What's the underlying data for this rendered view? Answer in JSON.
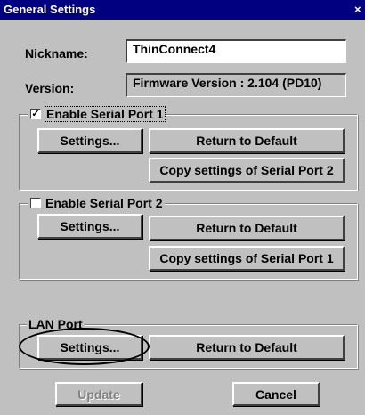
{
  "window": {
    "title": "General Settings",
    "close_glyph": "×"
  },
  "general": {
    "nickname_label": "Nickname:",
    "nickname_value": "ThinConnect4",
    "version_label": "Version:",
    "version_value": "Firmware Version : 2.104  (PD10)"
  },
  "serial1": {
    "enable_label": "Enable Serial Port 1",
    "checked": true,
    "check_glyph": "✓",
    "settings_label": "Settings...",
    "default_label": "Return to Default",
    "copy_label": "Copy settings of Serial Port 2"
  },
  "serial2": {
    "enable_label": "Enable Serial Port 2",
    "checked": false,
    "settings_label": "Settings...",
    "default_label": "Return to Default",
    "copy_label": "Copy settings of Serial Port 1"
  },
  "lan": {
    "group_label": "LAN Port",
    "settings_label": "Settings...",
    "default_label": "Return to Default"
  },
  "footer": {
    "update_label": "Update",
    "cancel_label": "Cancel"
  }
}
